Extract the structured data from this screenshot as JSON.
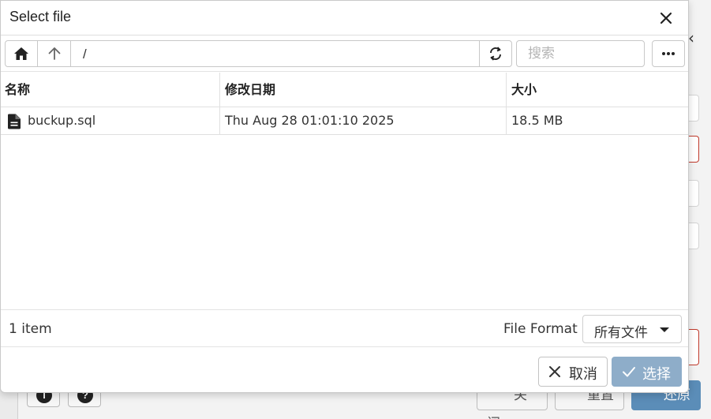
{
  "dialog": {
    "title": "Select file",
    "close_icon": "close-icon"
  },
  "toolbar": {
    "home_icon": "home-icon",
    "up_icon": "arrow-up-icon",
    "path": "/",
    "refresh_icon": "refresh-icon",
    "search_placeholder": "搜索",
    "more_icon": "more-horizontal-icon"
  },
  "table": {
    "columns": [
      "名称",
      "修改日期",
      "大小"
    ],
    "rows": [
      {
        "icon": "file-icon",
        "name": "buckup.sql",
        "modified": "Thu Aug 28 01:01:10 2025",
        "size": "18.5 MB"
      }
    ]
  },
  "status": {
    "item_count": "1 item",
    "format_label": "File Format",
    "format_value": "所有文件"
  },
  "footer": {
    "cancel_label": "取消",
    "select_label": "选择"
  },
  "background": {
    "close_label": "关闭",
    "reset_label": "重置",
    "submit_label": "还原"
  },
  "colors": {
    "primary_disabled": "#8eadc9",
    "accent": "#5b8db8",
    "error_border": "#c0392b"
  }
}
